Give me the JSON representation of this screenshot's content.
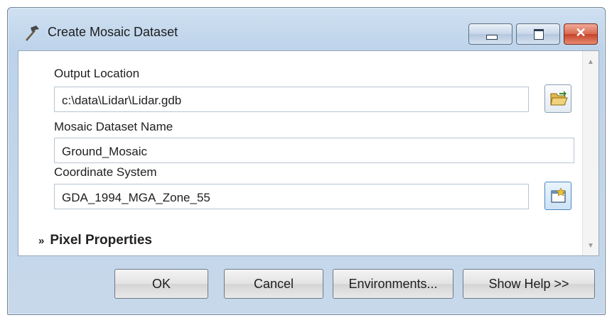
{
  "window": {
    "title": "Create Mosaic Dataset",
    "icon": "hammer-icon"
  },
  "form": {
    "output_location": {
      "label": "Output Location",
      "value": "c:\\data\\Lidar\\Lidar.gdb"
    },
    "mosaic_name": {
      "label": "Mosaic Dataset Name",
      "value": "Ground_Mosaic"
    },
    "coordinate_system": {
      "label": "Coordinate System",
      "value": "GDA_1994_MGA_Zone_55"
    },
    "pixel_properties": {
      "label": "Pixel Properties",
      "expander": "»"
    }
  },
  "buttons": {
    "ok": "OK",
    "cancel": "Cancel",
    "environments": "Environments...",
    "show_help": "Show Help >>"
  },
  "colors": {
    "titlebar": "#bdd3ea",
    "close_button": "#c4432a",
    "panel": "#ffffff"
  }
}
